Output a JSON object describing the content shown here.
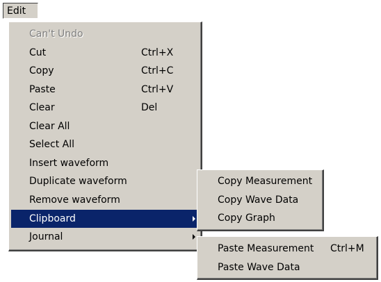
{
  "menubar": {
    "edit_label": "Edit"
  },
  "edit_menu": {
    "items": [
      {
        "label": "Can't Undo",
        "shortcut": ""
      },
      {
        "label": "Cut",
        "shortcut": "Ctrl+X"
      },
      {
        "label": "Copy",
        "shortcut": "Ctrl+C"
      },
      {
        "label": "Paste",
        "shortcut": "Ctrl+V"
      },
      {
        "label": "Clear",
        "shortcut": "Del"
      },
      {
        "label": "Clear All",
        "shortcut": ""
      },
      {
        "label": "Select All",
        "shortcut": ""
      },
      {
        "label": "Insert waveform",
        "shortcut": ""
      },
      {
        "label": "Duplicate waveform",
        "shortcut": ""
      },
      {
        "label": "Remove waveform",
        "shortcut": ""
      },
      {
        "label": "Clipboard",
        "shortcut": ""
      },
      {
        "label": "Journal",
        "shortcut": ""
      }
    ]
  },
  "clipboard_submenu": {
    "items": [
      {
        "label": "Copy Measurement"
      },
      {
        "label": "Copy Wave Data"
      },
      {
        "label": "Copy Graph"
      }
    ]
  },
  "journal_submenu": {
    "items": [
      {
        "label": "Paste Measurement",
        "shortcut": "Ctrl+M"
      },
      {
        "label": "Paste Wave Data"
      }
    ]
  },
  "colors": {
    "menu_background": "#d4d0c8",
    "selection_background": "#0a246a",
    "selection_text": "#ffffff",
    "disabled_text": "#808080"
  }
}
